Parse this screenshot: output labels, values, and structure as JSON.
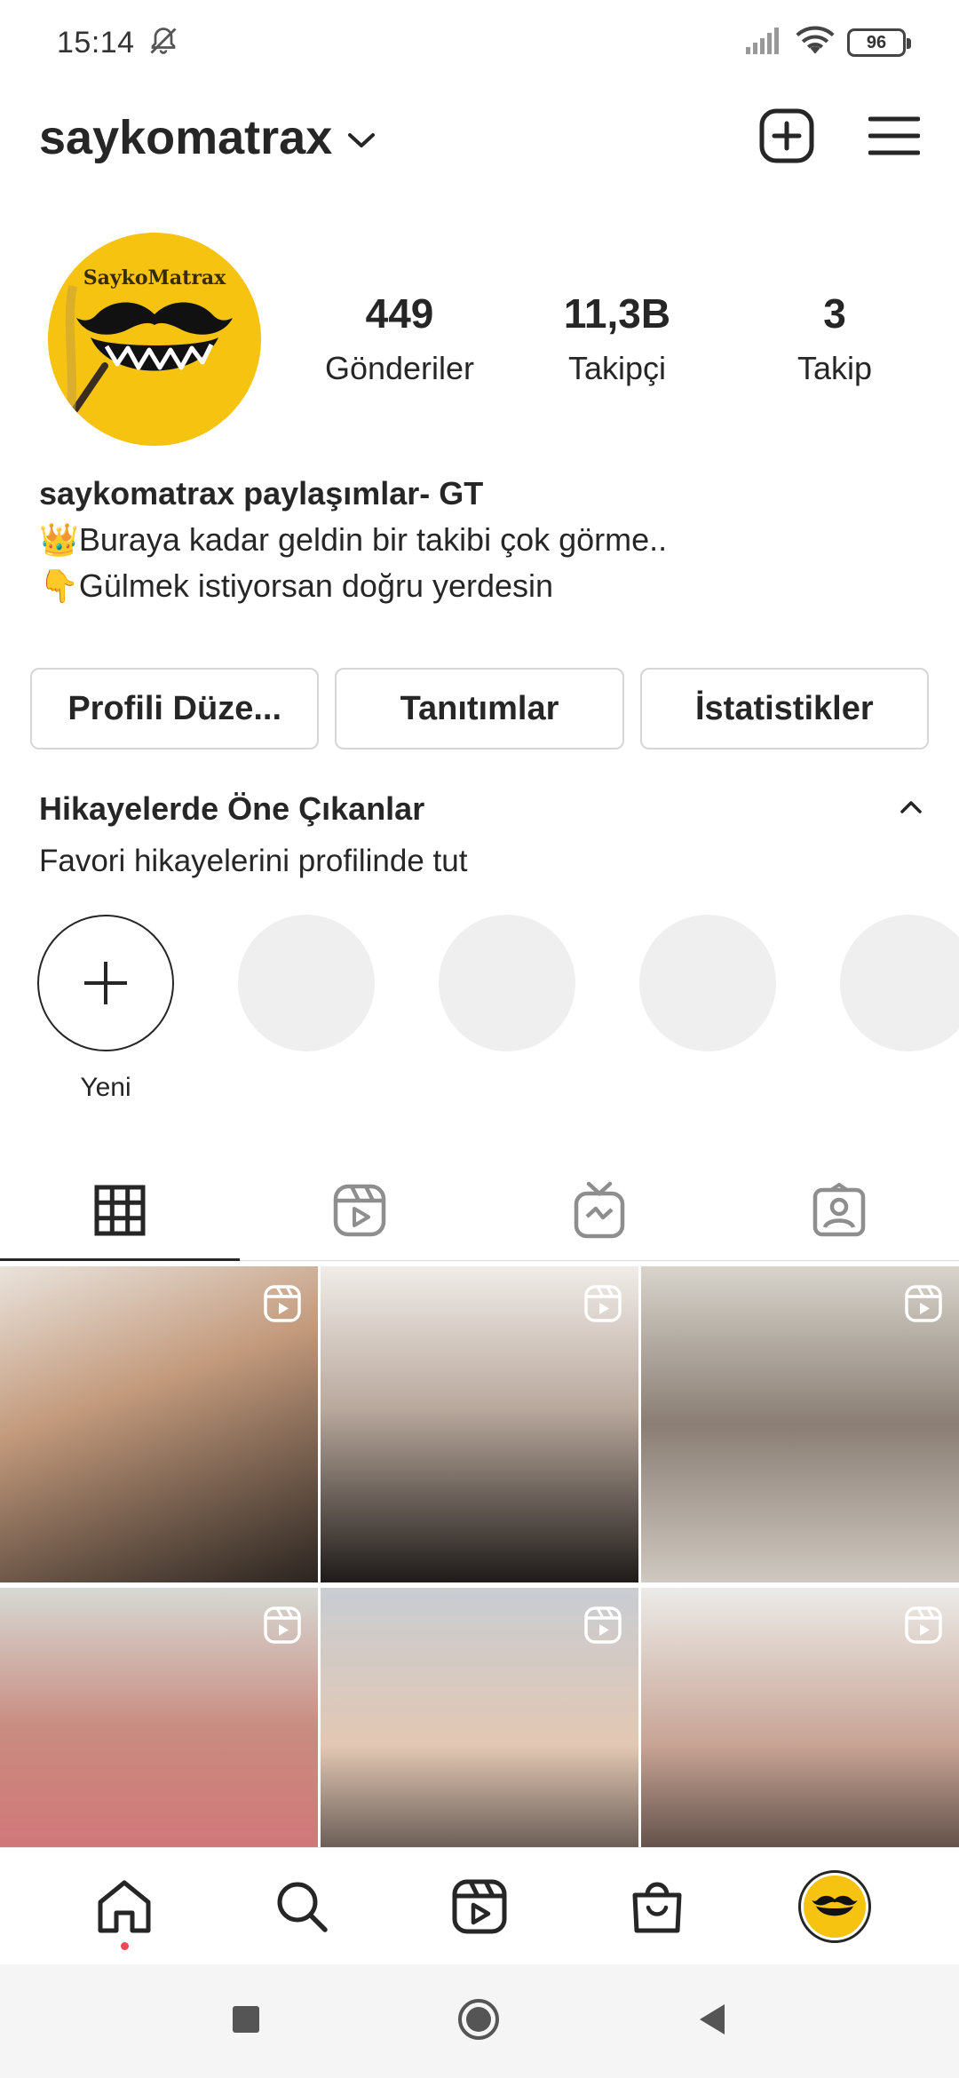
{
  "status_bar": {
    "time": "15:14",
    "battery": "96"
  },
  "header": {
    "username": "saykomatrax"
  },
  "profile": {
    "avatar_text": "SaykoMatrax",
    "stats": [
      {
        "value": "449",
        "label": "Gönderiler"
      },
      {
        "value": "11,3B",
        "label": "Takipçi"
      },
      {
        "value": "3",
        "label": "Takip"
      }
    ]
  },
  "bio": {
    "name": "saykomatrax paylaşımlar- GT",
    "lines": [
      "👑Buraya kadar geldin bir takibi çok görme..",
      "👇Gülmek istiyorsan doğru yerdesin"
    ]
  },
  "buttons": {
    "edit_profile": "Profili Düze...",
    "promotions": "Tanıtımlar",
    "insights": "İstatistikler"
  },
  "highlights": {
    "title": "Hikayelerde Öne Çıkanlar",
    "subtitle": "Favori hikayelerini profilinde tut",
    "new_label": "Yeni"
  },
  "tabs": [
    "grid-icon",
    "reels-icon",
    "igtv-icon",
    "tagged-icon"
  ],
  "posts": [
    {
      "bg": "#b89578"
    },
    {
      "bg": "#9c8b7f"
    },
    {
      "bg": "#8d8478"
    },
    {
      "bg": "#c78d86"
    },
    {
      "bg": "#d6c3b8"
    },
    {
      "bg": "#b0a49c"
    }
  ],
  "bottom_nav": [
    "home-icon",
    "search-icon",
    "reels-icon",
    "shop-icon",
    "profile-avatar"
  ],
  "colors": {
    "text": "#262626",
    "border": "#dbdbdb",
    "avatar_yellow": "#f6c310",
    "notification": "#ed4956"
  }
}
